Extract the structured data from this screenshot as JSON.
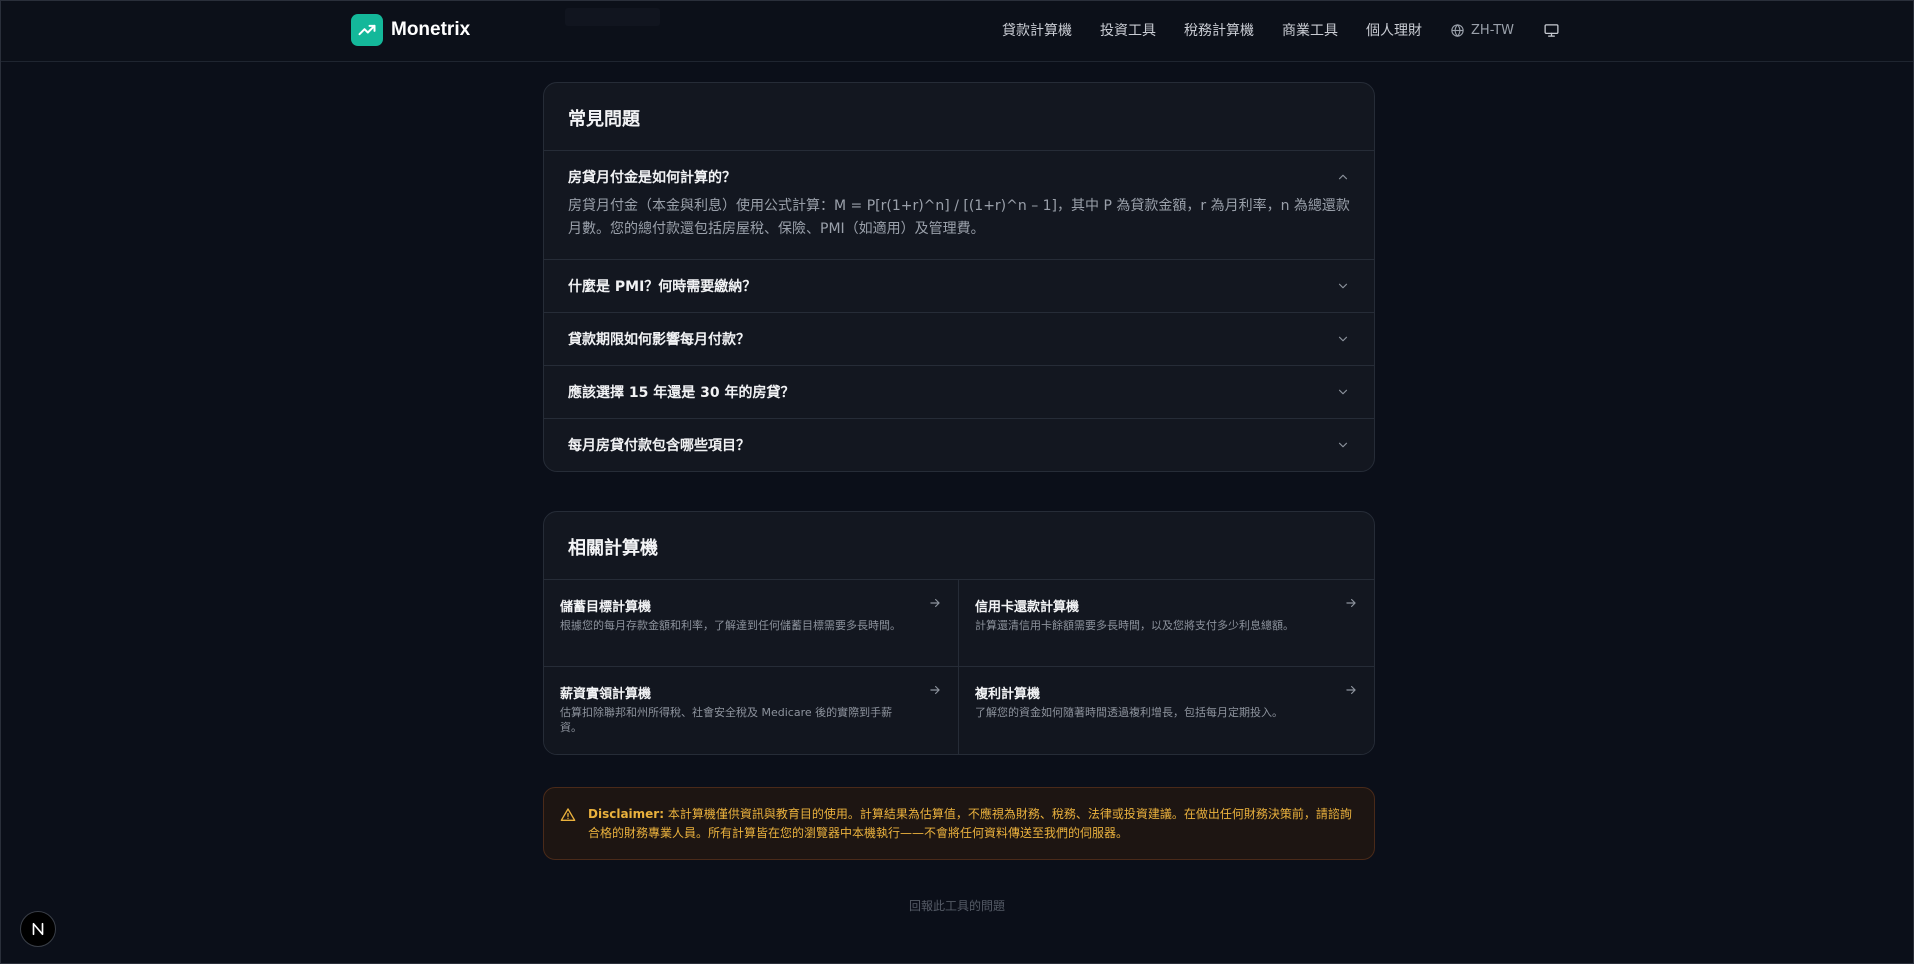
{
  "header": {
    "brand": "Monetrix",
    "logo_icon": "trending-up-icon",
    "brand_color": "#14b89a",
    "nav": [
      "貸款計算機",
      "投資工具",
      "稅務計算機",
      "商業工具",
      "個人理財"
    ],
    "language": "ZH-TW"
  },
  "faq": {
    "title": "常見問題",
    "items": [
      {
        "question": "房貸月付金是如何計算的？",
        "answer": "房貸月付金（本金與利息）使用公式計算：M = P[r(1+r)^n] / [(1+r)^n – 1]，其中 P 為貸款金額，r 為月利率，n 為總還款月數。您的總付款還包括房屋稅、保險、PMI（如適用）及管理費。",
        "expanded": true
      },
      {
        "question": "什麼是 PMI？何時需要繳納？",
        "expanded": false
      },
      {
        "question": "貸款期限如何影響每月付款？",
        "expanded": false
      },
      {
        "question": "應該選擇 15 年還是 30 年的房貸？",
        "expanded": false
      },
      {
        "question": "每月房貸付款包含哪些項目？",
        "expanded": false
      }
    ]
  },
  "related": {
    "title": "相關計算機",
    "items": [
      {
        "title": "儲蓄目標計算機",
        "description": "根據您的每月存款金額和利率，了解達到任何儲蓄目標需要多長時間。"
      },
      {
        "title": "信用卡還款計算機",
        "description": "計算還清信用卡餘額需要多長時間，以及您將支付多少利息總額。"
      },
      {
        "title": "薪資實領計算機",
        "description": "估算扣除聯邦和州所得稅、社會安全稅及 Medicare 後的實際到手薪資。"
      },
      {
        "title": "複利計算機",
        "description": "了解您的資金如何隨著時間透過複利增長，包括每月定期投入。"
      }
    ]
  },
  "disclaimer": {
    "label": "Disclaimer:",
    "text": "本計算機僅供資訊與教育目的使用。計算結果為估算值，不應視為財務、稅務、法律或投資建議。在做出任何財務決策前，請諮詢合格的財務專業人員。所有計算皆在您的瀏覽器中本機執行——不會將任何資料傳送至我們的伺服器。",
    "color": "#eab13d"
  },
  "footer": {
    "report_link": "回報此工具的問題"
  },
  "badge": {
    "letter": "N"
  }
}
